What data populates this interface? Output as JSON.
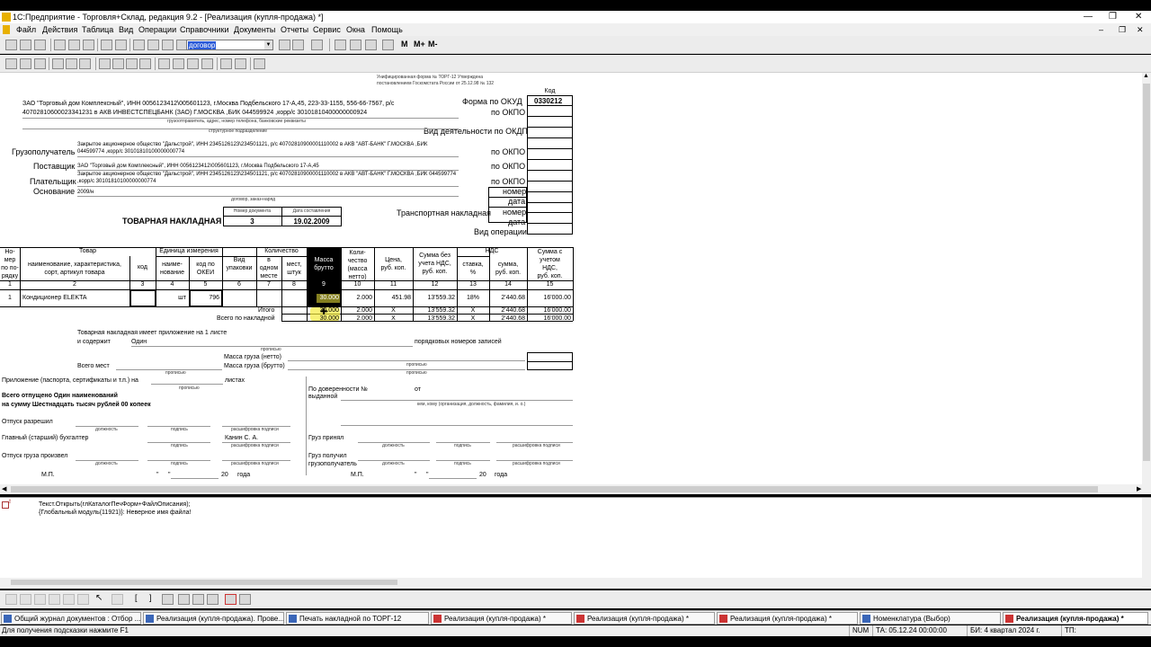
{
  "window": {
    "title": "1С:Предприятие - Торговля+Склад, редакция 9.2 - [Реализация (купля-продажа)  *]"
  },
  "menu": [
    "Файл",
    "Действия",
    "Таблица",
    "Вид",
    "Операции",
    "Справочники",
    "Документы",
    "Отчеты",
    "Сервис",
    "Окна",
    "Помощь"
  ],
  "toolbar": {
    "search_value": "договор"
  },
  "form": {
    "approved_line1": "Унифицированная форма № ТОРГ-12 Утверждена",
    "approved_line2": "постановлением Госкомстата России от 25.12.98 № 132",
    "code_header": "Код",
    "okud_label": "Форма по ОКУД",
    "okud_value": "0330212",
    "okpo_label": "по ОКПО",
    "okdp_label": "Вид деятельности по ОКДП",
    "org_line1": "ЗАО \"Торговый дом Комплексный\", ИНН 0056123412\\005601123, г.Москва Подбельского 17-А,45, 223-33-1155, 556-66-7567, р/с",
    "org_line2": "40702810600023341231 в АКВ ИНВЕСТСПЕЦБАНК (ЗАО) Г.МОСКВА ,БИК 044599924 ,корр/с 30101810400000000924",
    "org_caption": "грузоотправитель, адрес, номер телефона, банковские реквизиты",
    "subdivision_caption": "структурное подразделение",
    "consignee_label": "Грузополучатель",
    "consignee_line1": "Закрытое акционерное общество \"Дальстрой\", ИНН 2345126123\\234501121, р/с 40702810900001110002 в АКВ \"АВТ-БАНК\" Г.МОСКВА ,БИК",
    "consignee_line2": "044599774 ,корр/с 30101810100000000774",
    "supplier_label": "Поставщик",
    "supplier_line": "ЗАО \"Торговый дом Комплексный\", ИНН 0056123412\\005601123, г.Москва Подбельского 17-А,45",
    "payer_label": "Плательщик",
    "payer_line1": "Закрытое акционерное общество \"Дальстрой\", ИНН 2345126123\\234501121, р/с 40702810900001110002 в АКВ \"АВТ-БАНК\" Г.МОСКВА ,БИК 044599774",
    "payer_line2": ",корр/с 30101810100000000774",
    "basis_label": "Основание",
    "basis_value": "2009/н",
    "basis_caption": "договор, заказ-наряд",
    "number_label": "номер",
    "date_label": "дата",
    "transport_label": "Транспортная накладная",
    "operation_label": "Вид операции",
    "doc_title": "ТОВАРНАЯ НАКЛАДНАЯ",
    "doc_number_caption": "Номер документа",
    "doc_date_caption": "Дата составления",
    "doc_number": "3",
    "doc_date": "19.02.2009"
  },
  "table": {
    "h_num": [
      "Но-",
      "мер",
      "по по-",
      "рядку"
    ],
    "h_goods": "Товар",
    "h_goods_sub": [
      "наименование, характеристика,",
      "сорт, артикул товара"
    ],
    "h_code": "код",
    "h_unit": "Единица измерения",
    "h_unit_name": [
      "наиме-",
      "нование"
    ],
    "h_unit_okei": [
      "код по",
      "ОКЕИ"
    ],
    "h_pack": [
      "Вид",
      "упаковки"
    ],
    "h_qty": "Количество",
    "h_qty_one": [
      "в",
      "одном",
      "месте"
    ],
    "h_qty_places": [
      "мест,",
      "штук"
    ],
    "h_gross": [
      "Масса",
      "брутто"
    ],
    "h_net": [
      "Коли-",
      "чество",
      "(масса",
      "нетто)"
    ],
    "h_price": [
      "Цена,",
      "руб. коп."
    ],
    "h_sum_novat": [
      "Сумма без",
      "учета НДС,",
      "руб. коп."
    ],
    "h_vat": "НДС",
    "h_vat_rate": [
      "ставка,",
      "%"
    ],
    "h_vat_sum": [
      "сумма,",
      "руб. коп."
    ],
    "h_total": [
      "Сумма с",
      "учетом",
      "НДС,",
      "руб. коп."
    ],
    "col_numbers": [
      "1",
      "2",
      "3",
      "4",
      "5",
      "6",
      "7",
      "8",
      "9",
      "10",
      "11",
      "12",
      "13",
      "14",
      "15"
    ],
    "row": {
      "n": "1",
      "name": "Кондиционер ELEKTA",
      "unit": "шт",
      "okei": "796",
      "gross": "30.000",
      "qty": "2.000",
      "price": "451.98",
      "sum": "13'559.32",
      "rate": "18%",
      "vat": "2'440.68",
      "total": "16'000.00"
    },
    "itogo_label": "Итого",
    "vsego_label": "Всего по накладной",
    "itogo": {
      "gross": "30.000",
      "qty": "2.000",
      "price": "X",
      "sum": "13'559.32",
      "rate": "X",
      "vat": "2'440.68",
      "total": "16'000.00"
    },
    "vsego": {
      "gross": "30.000",
      "qty": "2.000",
      "price": "X",
      "sum": "13'559.32",
      "rate": "X",
      "vat": "2'440.68",
      "total": "16'000.00"
    }
  },
  "footer": {
    "attach_line": "Товарная накладная имеет приложение на 1 листе",
    "contains": "и содержит",
    "contains_value": "Один",
    "records": "порядковых номеров записей",
    "in_words": "прописью",
    "net_label": "Масса груза (нетто)",
    "gross_label": "Масса груза (брутто)",
    "places_label": "Всего мест",
    "appendix": "Приложение (паспорта, сертификаты и т.п.) на",
    "sheets": "листах",
    "released_line1": "Всего отпущено Один наименований",
    "released_line2": "на сумму Шестнадцать тысяч рублей 00 копеек",
    "proxy": "По доверенности №",
    "from": "от",
    "issued": "выданной",
    "issued_caption": "кем, кому (организация, должность, фамилия, и. о.)",
    "release_allowed": "Отпуск разрешил",
    "chief_accountant": "Главный (старший) бухгалтер",
    "accountant_name": "Канин С. А.",
    "release_done": "Отпуск груза произвел",
    "cargo_accepted": "Груз принял",
    "cargo_received": "Груз получил",
    "consignee_short": "грузополучатель",
    "cap_position": "должность",
    "cap_signature": "подпись",
    "cap_decoding": "расшифровка подписи",
    "mp": "М.П.",
    "quote": "\"",
    "year_20": "20",
    "year_word": "года"
  },
  "messages": {
    "line1": "Текст.Открыть(глКаталогПечФорм+ФайлОписания);",
    "line2": "{Глобальный модуль(11921)}: Неверное имя файла!"
  },
  "taskbar": [
    {
      "label": "Общий журнал документов : Отбор ...",
      "active": false
    },
    {
      "label": "Реализация (купля-продажа). Прове...",
      "active": false
    },
    {
      "label": "Печать накладной по ТОРГ-12",
      "active": false
    },
    {
      "label": "Реализация (купля-продажа)  *",
      "active": false
    },
    {
      "label": "Реализация (купля-продажа)  *",
      "active": false
    },
    {
      "label": "Реализация (купля-продажа)  *",
      "active": false
    },
    {
      "label": "Номенклатура (Выбор)",
      "active": false
    },
    {
      "label": "Реализация (купля-продажа)  *",
      "active": true
    }
  ],
  "status": {
    "hint": "Для получения подсказки нажмите F1",
    "num": "NUM",
    "ta": "ТА: 05.12.24  00:00:00",
    "bi": "БИ: 4 квартал 2024 г.",
    "tp": "ТП:"
  },
  "colors": {
    "selected_column": "#000000",
    "cursor_highlight": "#f3ea3a"
  }
}
